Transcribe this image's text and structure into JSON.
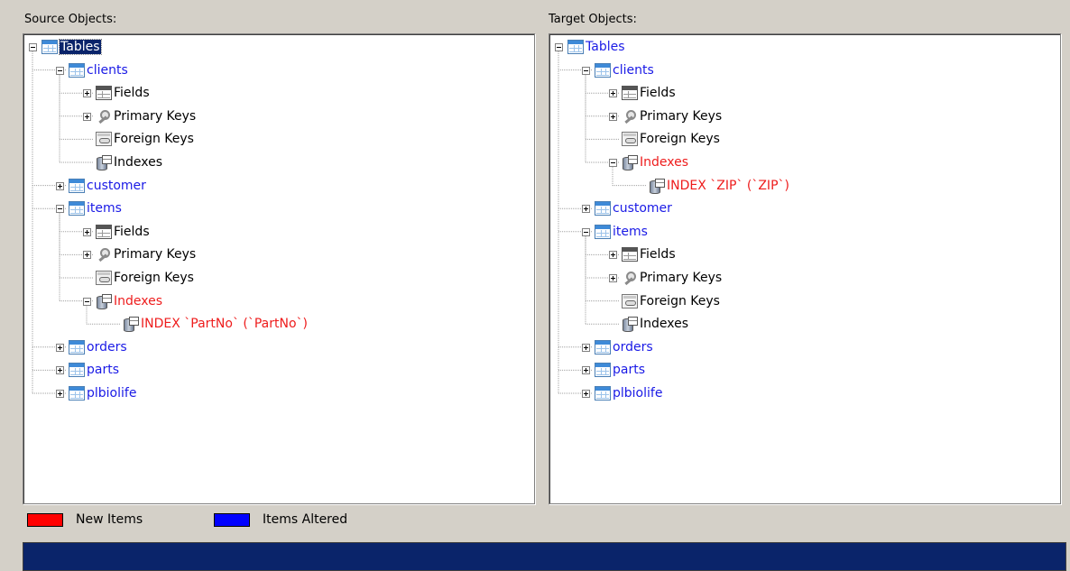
{
  "source_label": "Source Objects:",
  "target_label": "Target Objects:",
  "source_tree": [
    {
      "label": "Tables",
      "icon": "table-icon",
      "color": "selected",
      "depth": 0,
      "expander": "minus"
    },
    {
      "label": "clients",
      "icon": "table-icon",
      "color": "blue",
      "depth": 1,
      "expander": "minus"
    },
    {
      "label": "Fields",
      "icon": "fields-icon",
      "color": "black",
      "depth": 2,
      "expander": "plus"
    },
    {
      "label": "Primary Keys",
      "icon": "key-icon",
      "color": "black",
      "depth": 2,
      "expander": "plus"
    },
    {
      "label": "Foreign Keys",
      "icon": "foreign-keys-icon",
      "color": "black",
      "depth": 2,
      "expander": "none"
    },
    {
      "label": "Indexes",
      "icon": "index-icon",
      "color": "black",
      "depth": 2,
      "expander": "none"
    },
    {
      "label": "customer",
      "icon": "table-icon",
      "color": "blue",
      "depth": 1,
      "expander": "plus"
    },
    {
      "label": "items",
      "icon": "table-icon",
      "color": "blue",
      "depth": 1,
      "expander": "minus"
    },
    {
      "label": "Fields",
      "icon": "fields-icon",
      "color": "black",
      "depth": 2,
      "expander": "plus"
    },
    {
      "label": "Primary Keys",
      "icon": "key-icon",
      "color": "black",
      "depth": 2,
      "expander": "plus"
    },
    {
      "label": "Foreign Keys",
      "icon": "foreign-keys-icon",
      "color": "black",
      "depth": 2,
      "expander": "none"
    },
    {
      "label": "Indexes",
      "icon": "index-icon",
      "color": "red",
      "depth": 2,
      "expander": "minus"
    },
    {
      "label": "INDEX `PartNo` (`PartNo`)",
      "icon": "index-icon",
      "color": "red",
      "depth": 3,
      "expander": "none"
    },
    {
      "label": "orders",
      "icon": "table-icon",
      "color": "blue",
      "depth": 1,
      "expander": "plus"
    },
    {
      "label": "parts",
      "icon": "table-icon",
      "color": "blue",
      "depth": 1,
      "expander": "plus"
    },
    {
      "label": "plbiolife",
      "icon": "table-icon",
      "color": "blue",
      "depth": 1,
      "expander": "plus"
    }
  ],
  "target_tree": [
    {
      "label": "Tables",
      "icon": "table-icon",
      "color": "blue",
      "depth": 0,
      "expander": "minus"
    },
    {
      "label": "clients",
      "icon": "table-icon",
      "color": "blue",
      "depth": 1,
      "expander": "minus"
    },
    {
      "label": "Fields",
      "icon": "fields-icon",
      "color": "black",
      "depth": 2,
      "expander": "plus"
    },
    {
      "label": "Primary Keys",
      "icon": "key-icon",
      "color": "black",
      "depth": 2,
      "expander": "plus"
    },
    {
      "label": "Foreign Keys",
      "icon": "foreign-keys-icon",
      "color": "black",
      "depth": 2,
      "expander": "none"
    },
    {
      "label": "Indexes",
      "icon": "index-icon",
      "color": "red",
      "depth": 2,
      "expander": "minus"
    },
    {
      "label": "INDEX `ZIP` (`ZIP`)",
      "icon": "index-icon",
      "color": "red",
      "depth": 3,
      "expander": "none"
    },
    {
      "label": "customer",
      "icon": "table-icon",
      "color": "blue",
      "depth": 1,
      "expander": "plus"
    },
    {
      "label": "items",
      "icon": "table-icon",
      "color": "blue",
      "depth": 1,
      "expander": "minus"
    },
    {
      "label": "Fields",
      "icon": "fields-icon",
      "color": "black",
      "depth": 2,
      "expander": "plus"
    },
    {
      "label": "Primary Keys",
      "icon": "key-icon",
      "color": "black",
      "depth": 2,
      "expander": "plus"
    },
    {
      "label": "Foreign Keys",
      "icon": "foreign-keys-icon",
      "color": "black",
      "depth": 2,
      "expander": "none"
    },
    {
      "label": "Indexes",
      "icon": "index-icon",
      "color": "black",
      "depth": 2,
      "expander": "none"
    },
    {
      "label": "orders",
      "icon": "table-icon",
      "color": "blue",
      "depth": 1,
      "expander": "plus"
    },
    {
      "label": "parts",
      "icon": "table-icon",
      "color": "blue",
      "depth": 1,
      "expander": "plus"
    },
    {
      "label": "plbiolife",
      "icon": "table-icon",
      "color": "blue",
      "depth": 1,
      "expander": "plus"
    }
  ],
  "legend": {
    "new_items_label": "New Items",
    "new_items_color": "#ff0000",
    "altered_items_label": "Items Altered",
    "altered_items_color": "#0000ff"
  },
  "colors": {
    "status_bar": "#0a246a",
    "panel_bg": "#d4d0c8"
  }
}
